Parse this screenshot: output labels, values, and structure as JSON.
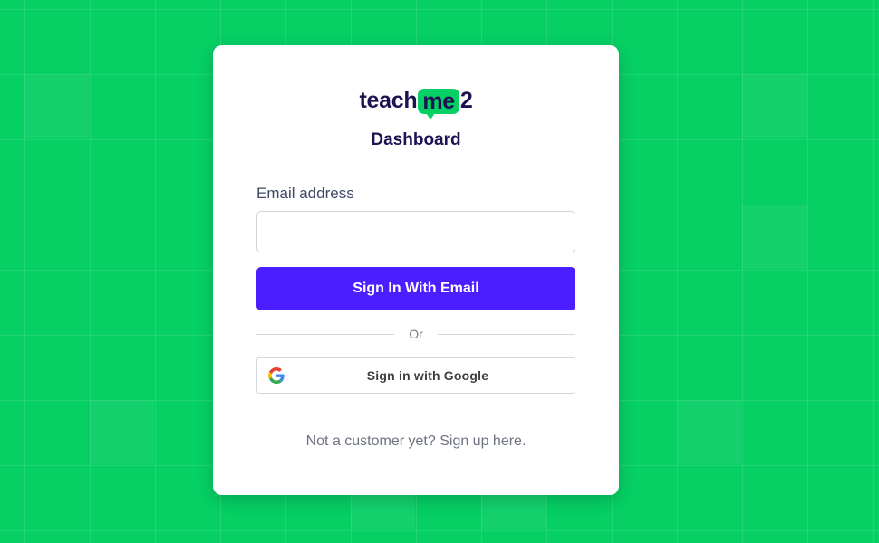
{
  "brand": {
    "logo_prefix": "teach",
    "logo_bubble": "me",
    "logo_suffix": "2",
    "subtitle": "Dashboard"
  },
  "form": {
    "email_label": "Email address",
    "email_value": "",
    "email_placeholder": "",
    "submit_label": "Sign In With Email",
    "divider_text": "Or",
    "google_label": "Sign in with Google",
    "google_icon": "google-g-icon",
    "signup_text": "Not a customer yet? Sign up here."
  },
  "colors": {
    "background": "#06cf64",
    "brand_dark": "#1b1352",
    "primary_button": "#4a1eff",
    "card": "#ffffff"
  }
}
